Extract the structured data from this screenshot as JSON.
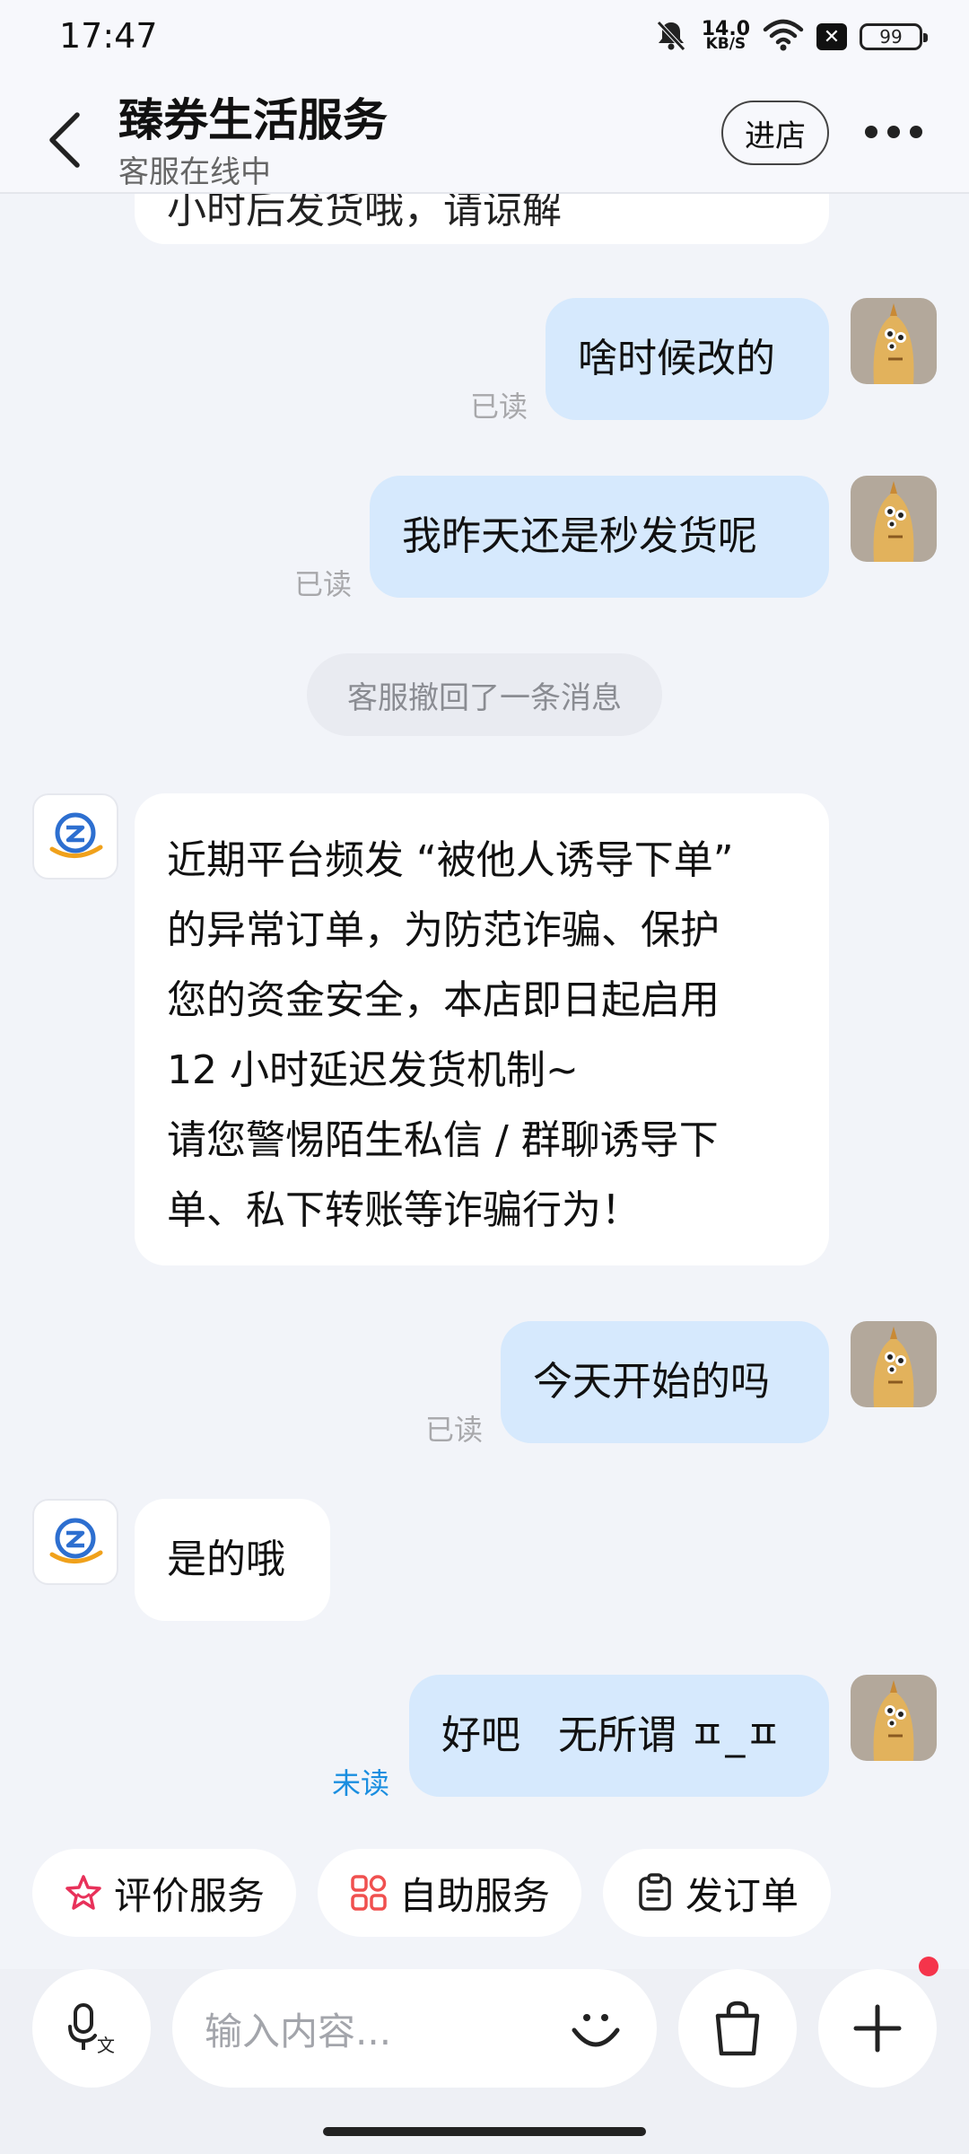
{
  "status_bar": {
    "time": "17:47",
    "net_speed_value": "14.0",
    "net_speed_unit": "KB/S",
    "battery": "99",
    "icons": [
      "mute-icon",
      "wifi-icon",
      "no-sim-icon",
      "battery-icon"
    ]
  },
  "header": {
    "title": "臻券生活服务",
    "subtitle": "客服在线中",
    "enter_store_label": "进店"
  },
  "chat": {
    "truncated_top_text": "小时后发货哦，请谅解",
    "messages": [
      {
        "sender": "user",
        "text": "啥时候改的",
        "status": "已读"
      },
      {
        "sender": "user",
        "text": "我昨天还是秒发货呢",
        "status": "已读"
      },
      {
        "sender": "system",
        "text": "客服撤回了一条消息"
      },
      {
        "sender": "shop",
        "lines": [
          "近期平台频发 “被他人诱导下单”",
          "的异常订单，为防范诈骗、保护",
          "您的资金安全，本店即日起启用",
          "12 小时延迟发货机制~",
          "请您警惕陌生私信 / 群聊诱导下",
          "单、私下转账等诈骗行为！"
        ]
      },
      {
        "sender": "user",
        "text": "今天开始的吗",
        "status": "已读"
      },
      {
        "sender": "shop",
        "text": "是的哦"
      },
      {
        "sender": "user",
        "text": "好吧   无所谓 ㅍ_ㅍ",
        "status": "未读"
      }
    ]
  },
  "quick_actions": [
    {
      "label": "评价服务",
      "icon": "star-icon"
    },
    {
      "label": "自助服务",
      "icon": "grid-icon"
    },
    {
      "label": "发订单",
      "icon": "order-icon"
    }
  ],
  "input": {
    "placeholder": "输入内容..."
  },
  "colors": {
    "outgoing_bubble": "#d6e9fd",
    "incoming_bubble": "#ffffff",
    "unread": "#1a8ee0",
    "notification_dot": "#f5344b",
    "star_icon": "#e8315a"
  }
}
